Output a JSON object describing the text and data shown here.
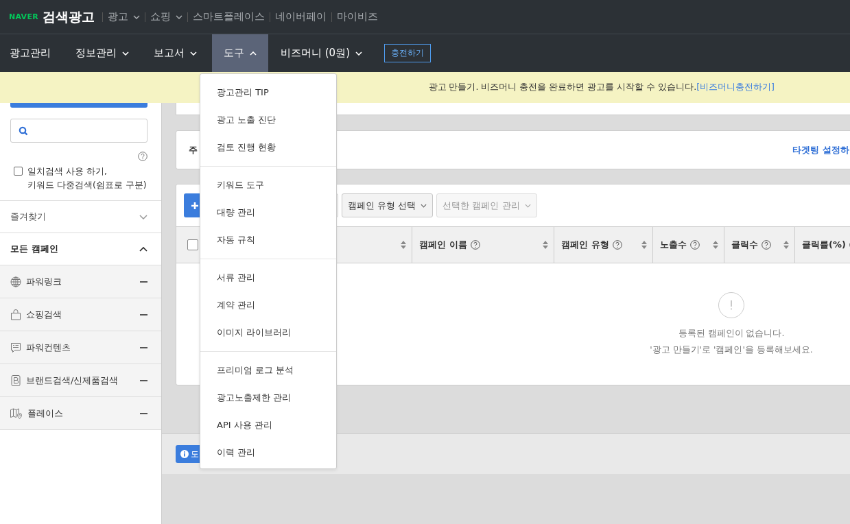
{
  "brand": {
    "logo": "NAVER",
    "title": "검색광고"
  },
  "top_links": [
    {
      "label": "광고",
      "caret": true
    },
    {
      "label": "쇼핑",
      "caret": true
    },
    {
      "label": "스마트플레이스",
      "caret": false
    },
    {
      "label": "네이버페이",
      "caret": false
    },
    {
      "label": "마이비즈",
      "caret": false
    }
  ],
  "nav": [
    {
      "label": "광고관리",
      "has_menu": false,
      "selected": false
    },
    {
      "label": "정보관리",
      "has_menu": true,
      "expanded": false,
      "selected": false
    },
    {
      "label": "보고서",
      "has_menu": true,
      "expanded": false,
      "selected": false
    },
    {
      "label": "도구",
      "has_menu": true,
      "expanded": true,
      "selected": true
    },
    {
      "label": "비즈머니 (0원)",
      "has_menu": true,
      "expanded": false,
      "selected": false
    }
  ],
  "charge_button": "충전하기",
  "banner": {
    "text": "광고 만들기. 비즈머니 충전을 완료하면 광고를 시작할 수 있습니다.",
    "link": "[비즈머니충전하기]"
  },
  "sidebar": {
    "exact_search": {
      "lines": [
        "일치검색 사용 하기,",
        "키워드 다중검색(쉼표로 구분)"
      ],
      "checked": false
    },
    "favorites": {
      "label": "즐겨찾기",
      "expanded": false
    },
    "all_campaigns": {
      "label": "모든 캠페인",
      "expanded": true
    },
    "campaign_types": [
      {
        "label": "파워링크",
        "kind": "globe"
      },
      {
        "label": "쇼핑검색",
        "kind": "bag"
      },
      {
        "label": "파워컨텐츠",
        "kind": "chat"
      },
      {
        "label": "브랜드검색/신제품검색",
        "kind": "brand"
      },
      {
        "label": "플레이스",
        "kind": "map"
      }
    ]
  },
  "summary_card": {
    "title": "주",
    "link": "타겟팅 설정하"
  },
  "toolbar": {
    "type_select": "캠페인 유형 선택",
    "manage_select": {
      "label": "선택한 캠페인 관리",
      "disabled": true
    }
  },
  "table": {
    "select_all_checked": false,
    "columns": [
      {
        "label": "캠페인 이름",
        "help": true
      },
      {
        "label": "캠페인 유형",
        "help": true
      },
      {
        "label": "노출수",
        "help": true
      },
      {
        "label": "클릭수",
        "help": true
      },
      {
        "label": "클릭률(%)",
        "help": true
      }
    ],
    "empty": {
      "lines": [
        "등록된 캠페인이 없습니다.",
        "'광고 만들기'로 '캠페인'을 등록해보세요."
      ]
    }
  },
  "footer_button": "도",
  "dropdown": {
    "groups": [
      [
        "광고관리 TIP",
        "광고 노출 진단",
        "검토 진행 현황"
      ],
      [
        "키워드 도구",
        "대량 관리",
        "자동 규칙"
      ],
      [
        "서류 관리",
        "계약 관리",
        "이미지 라이브러리"
      ],
      [
        "프리미엄 로그 분석",
        "광고노출제한 관리",
        "API 사용 관리",
        "이력 관리"
      ]
    ]
  }
}
